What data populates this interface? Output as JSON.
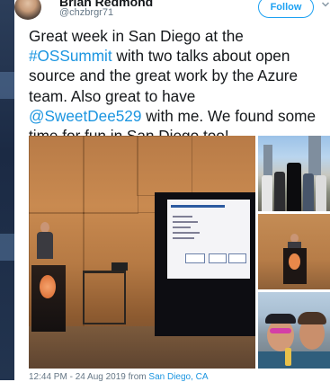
{
  "user": {
    "name": "Brian Redmond",
    "handle": "@chzbrgr71",
    "follow_label": "Follow"
  },
  "tweet": {
    "lines": [
      [
        {
          "text": "Great week in San Diego at the",
          "link": false
        }
      ],
      [
        {
          "text": "#OSSummit",
          "link": true
        },
        {
          "text": " with two talks about open",
          "link": false
        }
      ],
      [
        {
          "text": "source and the great work by the Azure",
          "link": false
        }
      ],
      [
        {
          "text": "team. Also great to have",
          "link": false
        }
      ],
      [
        {
          "text": "@SweetDee529",
          "link": true
        },
        {
          "text": " with me. We found some",
          "link": false
        }
      ],
      [
        {
          "text": "time for fun in San Diego too!",
          "link": false
        }
      ]
    ]
  },
  "media": {
    "photos": [
      {
        "subject": "conference-stage-photo"
      },
      {
        "subject": "star-wars-group-photo"
      },
      {
        "subject": "speaker-podium-photo"
      },
      {
        "subject": "selfie-photo"
      }
    ]
  },
  "footer": {
    "timestamp": "12:44 PM - 24 Aug 2019 from ",
    "location": "San Diego, CA"
  },
  "colors": {
    "link": "#1b95e0",
    "follow_accent": "#1da1f2",
    "secondary_text": "#657786"
  }
}
